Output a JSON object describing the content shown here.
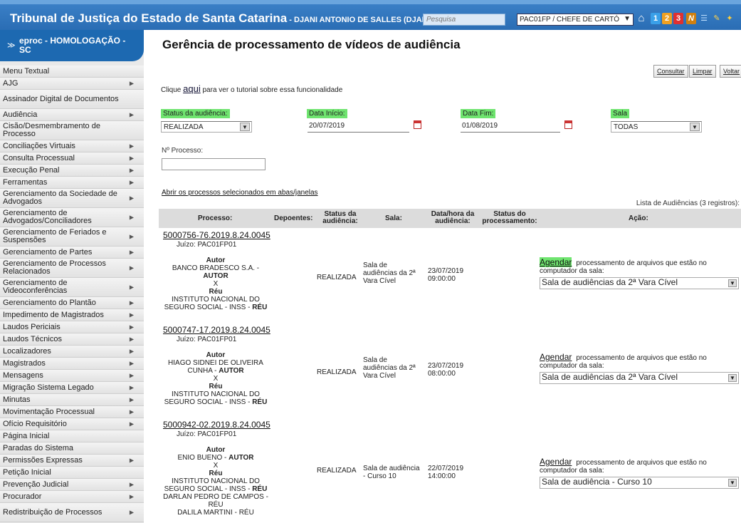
{
  "header": {
    "title": "Tribunal de Justiça do Estado de Santa Catarina",
    "user": " - DJANI ANTONIO DE SALLES (DJANI)",
    "search_placeholder": "Pesquisa",
    "profile": "PAC01FP / CHEFE DE CARTÓ",
    "badges": [
      "1",
      "2",
      "3"
    ]
  },
  "sidebar": {
    "title": "eproc - HOMOLOGAÇÃO - SC",
    "items": [
      {
        "label": "Menu Textual",
        "sub": false
      },
      {
        "label": "AJG",
        "sub": true
      },
      {
        "label": "Assinador Digital de Documentos",
        "sub": false
      },
      {
        "label": "Audiência",
        "sub": true
      },
      {
        "label": "Cisão/Desmembramento de Processo",
        "sub": false
      },
      {
        "label": "Conciliações Virtuais",
        "sub": true
      },
      {
        "label": "Consulta Processual",
        "sub": true
      },
      {
        "label": "Execução Penal",
        "sub": true
      },
      {
        "label": "Ferramentas",
        "sub": true
      },
      {
        "label": "Gerenciamento da Sociedade de Advogados",
        "sub": true
      },
      {
        "label": "Gerenciamento de Advogados/Conciliadores",
        "sub": true
      },
      {
        "label": "Gerenciamento de Feriados e Suspensões",
        "sub": true
      },
      {
        "label": "Gerenciamento de Partes",
        "sub": true
      },
      {
        "label": "Gerenciamento de Processos Relacionados",
        "sub": true
      },
      {
        "label": "Gerenciamento de Videoconferências",
        "sub": true
      },
      {
        "label": "Gerenciamento do Plantão",
        "sub": true
      },
      {
        "label": "Impedimento de Magistrados",
        "sub": true
      },
      {
        "label": "Laudos Periciais",
        "sub": true
      },
      {
        "label": "Laudos Técnicos",
        "sub": true
      },
      {
        "label": "Localizadores",
        "sub": true
      },
      {
        "label": "Magistrados",
        "sub": true
      },
      {
        "label": "Mensagens",
        "sub": true
      },
      {
        "label": "Migração Sistema Legado",
        "sub": true
      },
      {
        "label": "Minutas",
        "sub": true
      },
      {
        "label": "Movimentação Processual",
        "sub": true
      },
      {
        "label": "Ofício Requisitório",
        "sub": true
      },
      {
        "label": "Página Inicial",
        "sub": false
      },
      {
        "label": "Paradas do Sistema",
        "sub": false
      },
      {
        "label": "Permissões Expressas",
        "sub": true
      },
      {
        "label": "Petição Inicial",
        "sub": false
      },
      {
        "label": "Prevenção Judicial",
        "sub": true
      },
      {
        "label": "Procurador",
        "sub": true
      },
      {
        "label": "Redistribuição de Processos",
        "sub": true
      }
    ]
  },
  "page": {
    "title": "Gerência de processamento de vídeos de audiência",
    "buttons": {
      "consultar": "Consultar",
      "limpar": "Limpar",
      "voltar": "Voltar"
    },
    "tutorial_pre": "Clique ",
    "tutorial_link": "aqui",
    "tutorial_post": " para ver o tutorial sobre essa funcionalidade",
    "filters": {
      "status_label": "Status da audiência:",
      "status_value": "REALIZADA",
      "start_label": "Data Início:",
      "start_value": "20/07/2019",
      "end_label": "Data Fim:",
      "end_value": "01/08/2019",
      "room_label": "Sala",
      "room_value": "TODAS",
      "process_label": "Nº Processo:"
    },
    "open_link": "Abrir os processos selecionados em abas/janelas",
    "list_caption": "Lista de Audiências (3 registros):"
  },
  "table": {
    "headers": {
      "processo": "Processo:",
      "depoentes": "Depoentes:",
      "status": "Status da audiência:",
      "sala": "Sala:",
      "datahora": "Data/hora da audiência:",
      "status_proc": "Status do processamento:",
      "acao": "Ação:"
    },
    "rows": [
      {
        "processo": "5000756-76.2019.8.24.0045",
        "juizo": "Juízo: PAC01FP01",
        "autor_label": "Autor",
        "autor_name": "BANCO BRADESCO S.A. -",
        "autor_role": "AUTOR",
        "x": "X",
        "reu_label": "Réu",
        "reu_lines": [
          "INSTITUTO NACIONAL DO",
          "SEGURO SOCIAL - INSS - "
        ],
        "reu_role": "RÉU",
        "status": "REALIZADA",
        "sala": "Sala de audiências da 2ª Vara Cível",
        "data": "23/07/2019",
        "hora": "09:00:00",
        "agendar": "Agendar",
        "acao_text": "processamento de arquivos que estão no computador da sala:",
        "room": "Sala de audiências da 2ª Vara Cível"
      },
      {
        "processo": "5000747-17.2019.8.24.0045",
        "juizo": "Juízo: PAC01FP01",
        "autor_label": "Autor",
        "autor_name": "HIAGO SIDNEI DE OLIVEIRA CUNHA -",
        "autor_role": "AUTOR",
        "x": "X",
        "reu_label": "Réu",
        "reu_lines": [
          "INSTITUTO NACIONAL DO",
          "SEGURO SOCIAL - INSS - "
        ],
        "reu_role": "RÉU",
        "status": "REALIZADA",
        "sala": "Sala de audiências da 2ª Vara Cível",
        "data": "23/07/2019",
        "hora": "08:00:00",
        "agendar": "Agendar",
        "acao_text": "processamento de arquivos que estão no computador da sala:",
        "room": "Sala de audiências da 2ª Vara Cível"
      },
      {
        "processo": "5000942-02.2019.8.24.0045",
        "juizo": "Juízo: PAC01FP01",
        "autor_label": "Autor",
        "autor_name": "ENIO BUENO -",
        "autor_role": "AUTOR",
        "x": "X",
        "reu_label": "Réu",
        "reu_lines": [
          "INSTITUTO NACIONAL DO",
          "SEGURO SOCIAL - INSS - "
        ],
        "reu_role": "RÉU",
        "extra_reus": [
          "DARLAN PEDRO DE CAMPOS - RÉU",
          "DALILA MARTINI - RÉU"
        ],
        "status": "REALIZADA",
        "sala": "Sala de audiência - Curso 10",
        "data": "22/07/2019",
        "hora": "14:00:00",
        "agendar": "Agendar",
        "acao_text": "processamento de arquivos que estão no computador da sala:",
        "room": "Sala de audiência - Curso 10"
      }
    ]
  },
  "colors": {
    "topbar": "#2a6db4",
    "highlight": "#6fe46f",
    "sidebar_header": "#1d69b1"
  }
}
